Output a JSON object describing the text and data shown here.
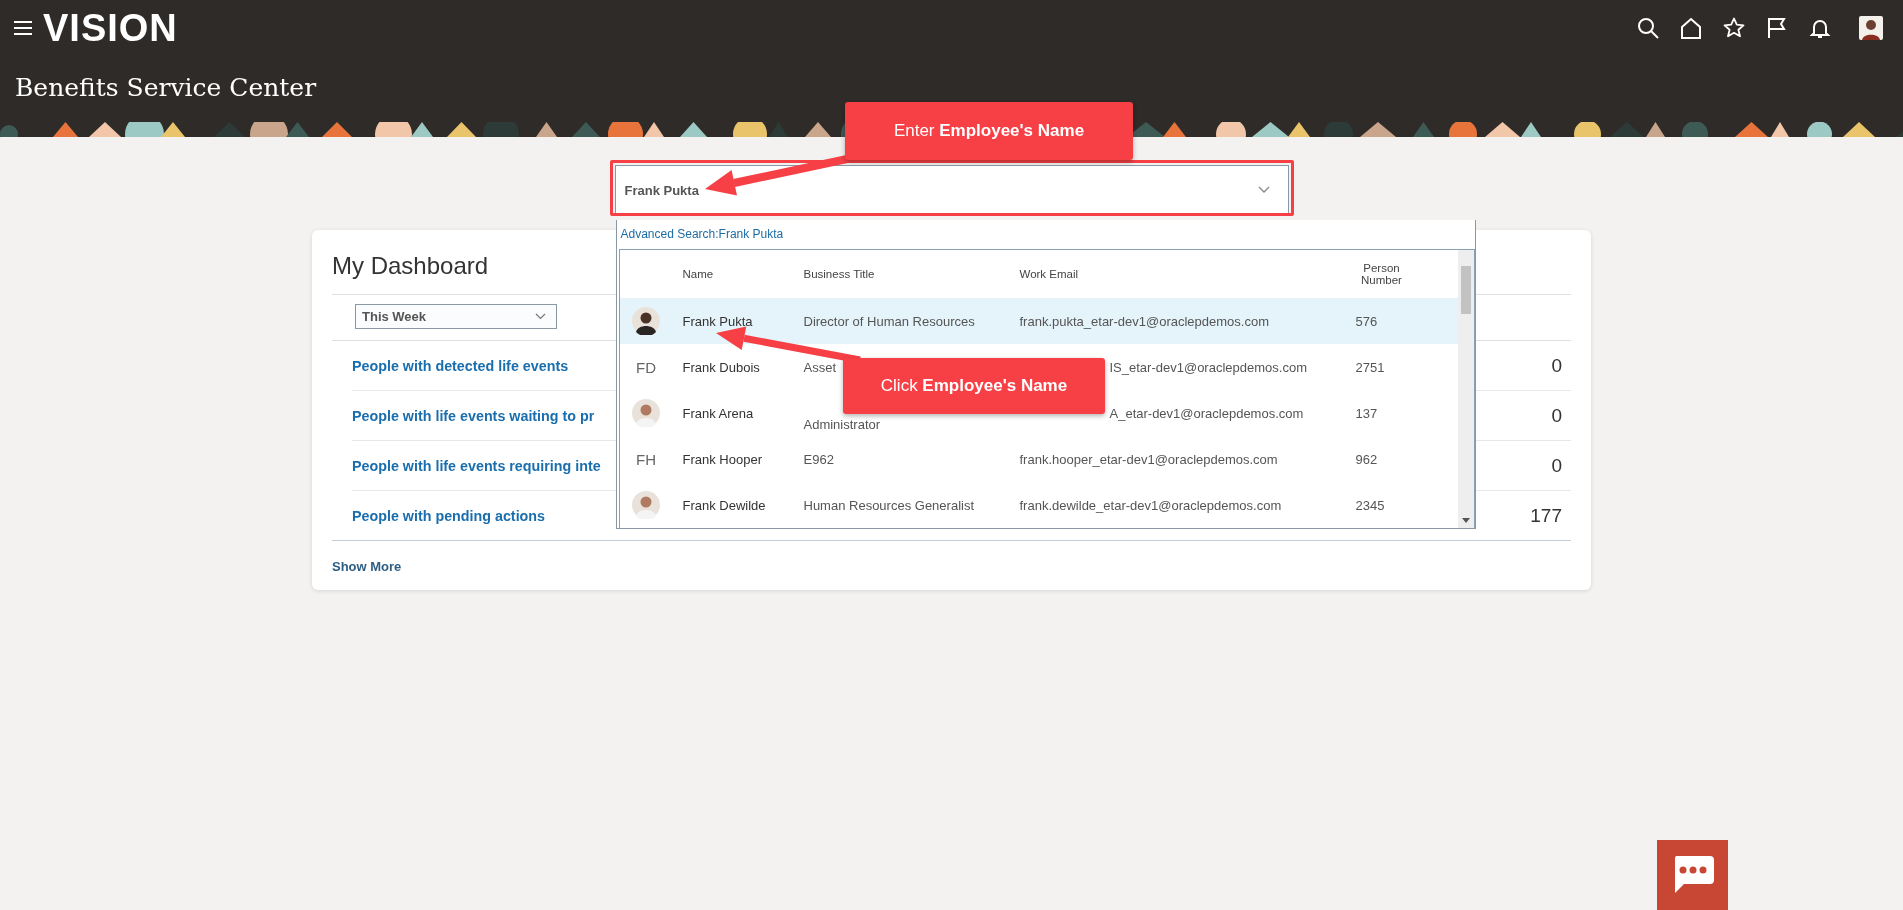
{
  "app_bar": {
    "logo": "VISION",
    "page_title": "Benefits Service Center"
  },
  "search": {
    "value": "Frank Pukta"
  },
  "results": {
    "advanced_search": "Advanced Search:Frank Pukta",
    "columns": [
      "Name",
      "Business Title",
      "Work Email",
      "Person Number"
    ],
    "rows": [
      {
        "name": "Frank Pukta",
        "title": "Director of Human Resources",
        "email": "frank.pukta_etar-dev1@oraclepdemos.com",
        "number": "576",
        "selected": true,
        "title_covered": false,
        "email_covered": false
      },
      {
        "avatar": {
          "kind": "initials",
          "initials": "FD"
        },
        "name": "Frank Dubois",
        "title": "Asset",
        "email": "IS_etar-dev1@oraclepdemos.com",
        "number": "2751",
        "selected": false,
        "title_covered": false,
        "email_covered": true
      },
      {
        "name": "Frank Arena",
        "title": "Administrator",
        "email": "A_etar-dev1@oraclepdemos.com",
        "number": "137",
        "selected": false,
        "title_covered": true,
        "email_covered": true
      },
      {
        "avatar": {
          "kind": "initials",
          "initials": "FH"
        },
        "name": "Frank Hooper",
        "title": "E962",
        "email": "frank.hooper_etar-dev1@oraclepdemos.com",
        "number": "962",
        "selected": false,
        "title_covered": false,
        "email_covered": false
      },
      {
        "name": "Frank Dewilde",
        "title": "Human Resources Generalist",
        "email": "frank.dewilde_etar-dev1@oraclepdemos.com",
        "number": "2345",
        "selected": false,
        "title_covered": false,
        "email_covered": false
      }
    ]
  },
  "dashboard": {
    "title": "My Dashboard",
    "period": "This Week",
    "items": [
      {
        "label": "People with detected life events",
        "count": "0"
      },
      {
        "label": "People with life events waiting to pr",
        "count": "0"
      },
      {
        "label": "People with life events requiring inte",
        "count": "0"
      },
      {
        "label": "People with pending actions",
        "count": "177"
      }
    ],
    "show_more": "Show More"
  },
  "callouts": [
    {
      "text": "Enter **Employee's Name**"
    },
    {
      "text": "Click **Employee's Name**"
    }
  ]
}
